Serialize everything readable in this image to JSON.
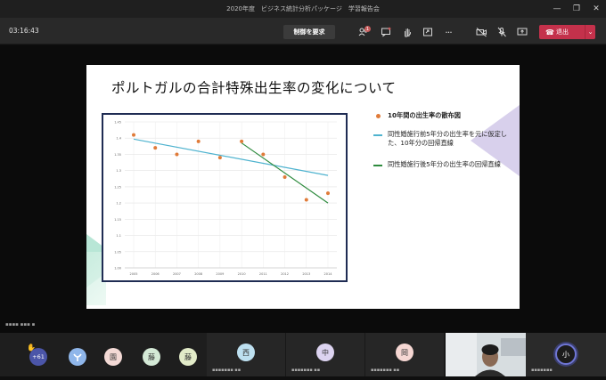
{
  "window": {
    "title": "2020年度　ビジネス統計分析パッケージ　学習報告会",
    "minimize": "—",
    "maximize": "❐",
    "close": "✕"
  },
  "toolbar": {
    "timer": "03:16:43",
    "request_control": "制御を要求",
    "participants_badge": "1",
    "leave": "退出"
  },
  "slide": {
    "title": "ポルトガルの合計特殊出生率の変化について",
    "legend": [
      {
        "label": "10年間の出生率の散布図"
      },
      {
        "label": "同性婚施行前5年分の出生率を元に仮定した、10年分の回帰直線"
      },
      {
        "label": "同性婚施行後5年分の出生率の回帰直線"
      }
    ]
  },
  "chart_data": {
    "type": "scatter",
    "x_categories": [
      "2005",
      "2006",
      "2007",
      "2008",
      "2009",
      "2010",
      "2011",
      "2012",
      "2013",
      "2014"
    ],
    "y_ticks": [
      "1.45",
      "1.4",
      "1.35",
      "1.3",
      "1.25",
      "1.2",
      "1.15",
      "1.1",
      "1.05",
      "1.00"
    ],
    "ylim": [
      1.0,
      1.45
    ],
    "series": [
      {
        "name": "10年間の出生率の散布図",
        "kind": "points",
        "color": "#e07b39",
        "values": [
          1.41,
          1.37,
          1.35,
          1.39,
          1.34,
          1.39,
          1.35,
          1.28,
          1.21,
          1.23
        ]
      },
      {
        "name": "同性婚施行前5年分の出生率を元に仮定した、10年分の回帰直線",
        "kind": "line",
        "color": "#4fb3cf",
        "start": {
          "x": "2005",
          "y": 1.397
        },
        "end": {
          "x": "2014",
          "y": 1.285
        }
      },
      {
        "name": "同性婚施行後5年分の出生率の回帰直線",
        "kind": "line",
        "color": "#2e8b3e",
        "start": {
          "x": "2010",
          "y": 1.385
        },
        "end": {
          "x": "2014",
          "y": 1.2
        }
      }
    ],
    "grid": true
  },
  "strip": {
    "overflow_count": "+61",
    "participants": [
      {
        "initial": "園",
        "color": "#f3d9d5"
      },
      {
        "initial": "藤",
        "color": "#d4e9d6"
      },
      {
        "initial": "藤",
        "color": "#e2ebc8"
      },
      {
        "initial": "西",
        "color": "#bde0f0"
      },
      {
        "initial": "中",
        "color": "#dcd3f0"
      },
      {
        "initial": "岡",
        "color": "#f6d7d3"
      },
      {
        "initial": "小",
        "color": "#1c1c1c"
      }
    ]
  }
}
